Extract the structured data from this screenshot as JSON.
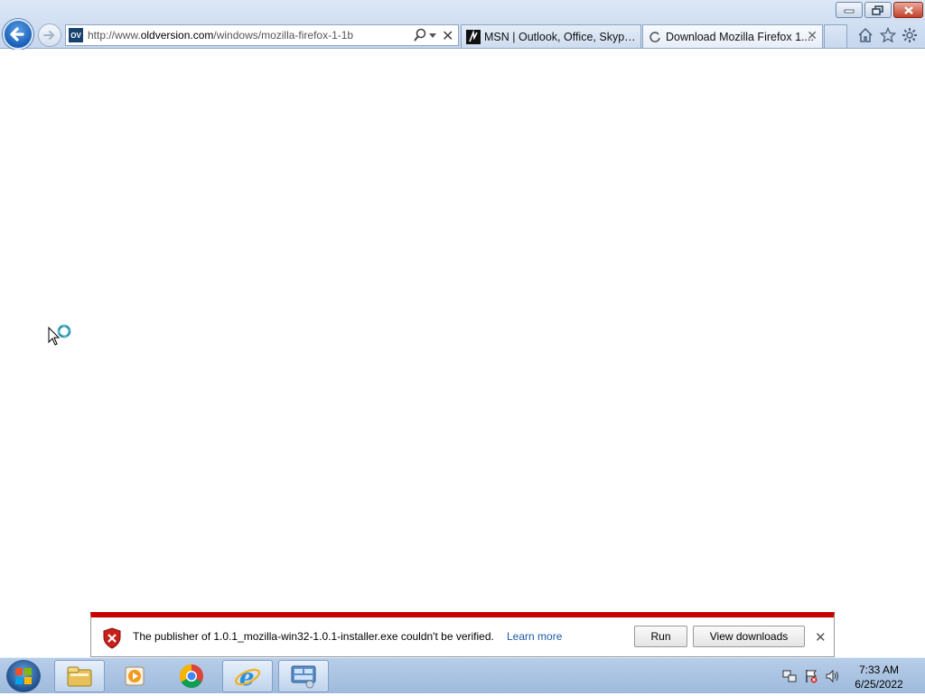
{
  "browser": {
    "address": {
      "scheme": "http://www.",
      "host": "oldversion.com",
      "path": "/windows/mozilla-firefox-1-1b",
      "site_icon_text": "OV"
    },
    "tabs": [
      {
        "label": "MSN | Outlook, Office, Skype, ...",
        "active": false
      },
      {
        "label": "Download Mozilla Firefox 1....",
        "active": true
      }
    ]
  },
  "notification": {
    "message": "The publisher of 1.0.1_mozilla-win32-1.0.1-installer.exe couldn't be verified.",
    "learn_more": "Learn more",
    "run_label": "Run",
    "view_downloads_label": "View downloads",
    "accent_color": "#c80000"
  },
  "taskbar": {
    "items": [
      "start-orb",
      "windows-explorer-icon",
      "media-player-icon",
      "chrome-icon",
      "internet-explorer-icon",
      "control-panel-icon"
    ],
    "clock": {
      "time": "7:33 AM",
      "date": "6/25/2022"
    }
  },
  "icons": [
    "back-arrow-icon",
    "forward-arrow-icon",
    "search-icon",
    "stop-icon",
    "home-icon",
    "favorites-star-icon",
    "tools-gear-icon",
    "shield-warning-icon",
    "busy-cursor-icon"
  ]
}
